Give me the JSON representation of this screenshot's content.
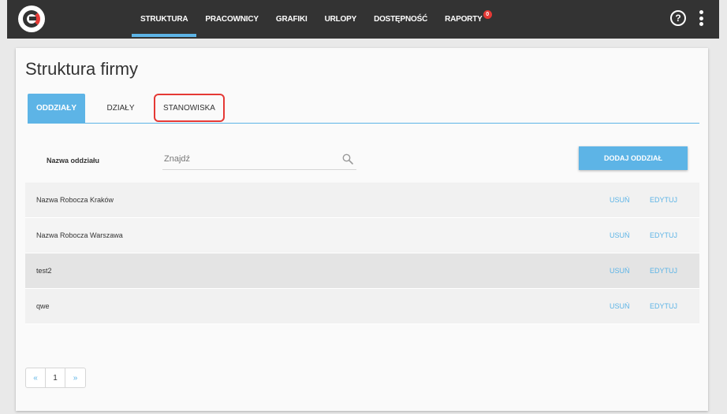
{
  "nav": {
    "items": [
      {
        "label": "STRUKTURA"
      },
      {
        "label": "PRACOWNICY"
      },
      {
        "label": "GRAFIKI"
      },
      {
        "label": "URLOPY"
      },
      {
        "label": "DOSTĘPNOŚĆ"
      },
      {
        "label": "RAPORTY",
        "badge": "0"
      }
    ],
    "help_label": "?"
  },
  "page": {
    "title": "Struktura firmy"
  },
  "tabs": [
    {
      "label": "ODDZIAŁY"
    },
    {
      "label": "DZIAŁY"
    },
    {
      "label": "STANOWISKA"
    }
  ],
  "filter": {
    "label": "Nazwa oddziału",
    "placeholder": "Znajdź"
  },
  "add_button_label": "DODAJ ODDZIAŁ",
  "rows": [
    {
      "name": "Nazwa Robocza Kraków",
      "delete": "USUŃ",
      "edit": "EDYTUJ"
    },
    {
      "name": "Nazwa Robocza Warszawa",
      "delete": "USUŃ",
      "edit": "EDYTUJ"
    },
    {
      "name": "test2",
      "delete": "USUŃ",
      "edit": "EDYTUJ"
    },
    {
      "name": "qwe",
      "delete": "USUŃ",
      "edit": "EDYTUJ"
    }
  ],
  "pagination": {
    "prev": "«",
    "current": "1",
    "next": "»"
  },
  "colors": {
    "accent": "#5db4e6",
    "topbar": "#333333",
    "highlight": "#e53935"
  }
}
